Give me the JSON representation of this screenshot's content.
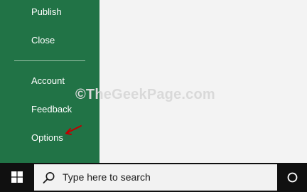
{
  "backstage": {
    "items": [
      {
        "label": "Publish"
      },
      {
        "label": "Close"
      },
      {
        "label": "Account"
      },
      {
        "label": "Feedback"
      },
      {
        "label": "Options"
      }
    ]
  },
  "watermark": {
    "text": "©TheGeekPage.com"
  },
  "taskbar": {
    "start_icon": "windows-logo-icon",
    "search": {
      "placeholder": "Type here to search",
      "icon": "search-icon"
    },
    "cortana_icon": "cortana-icon"
  },
  "colors": {
    "nav_background": "#217346",
    "nav_text": "#ffffff",
    "main_background": "#f3f3f3",
    "taskbar_background": "#101010",
    "arrow": "#c00000"
  }
}
